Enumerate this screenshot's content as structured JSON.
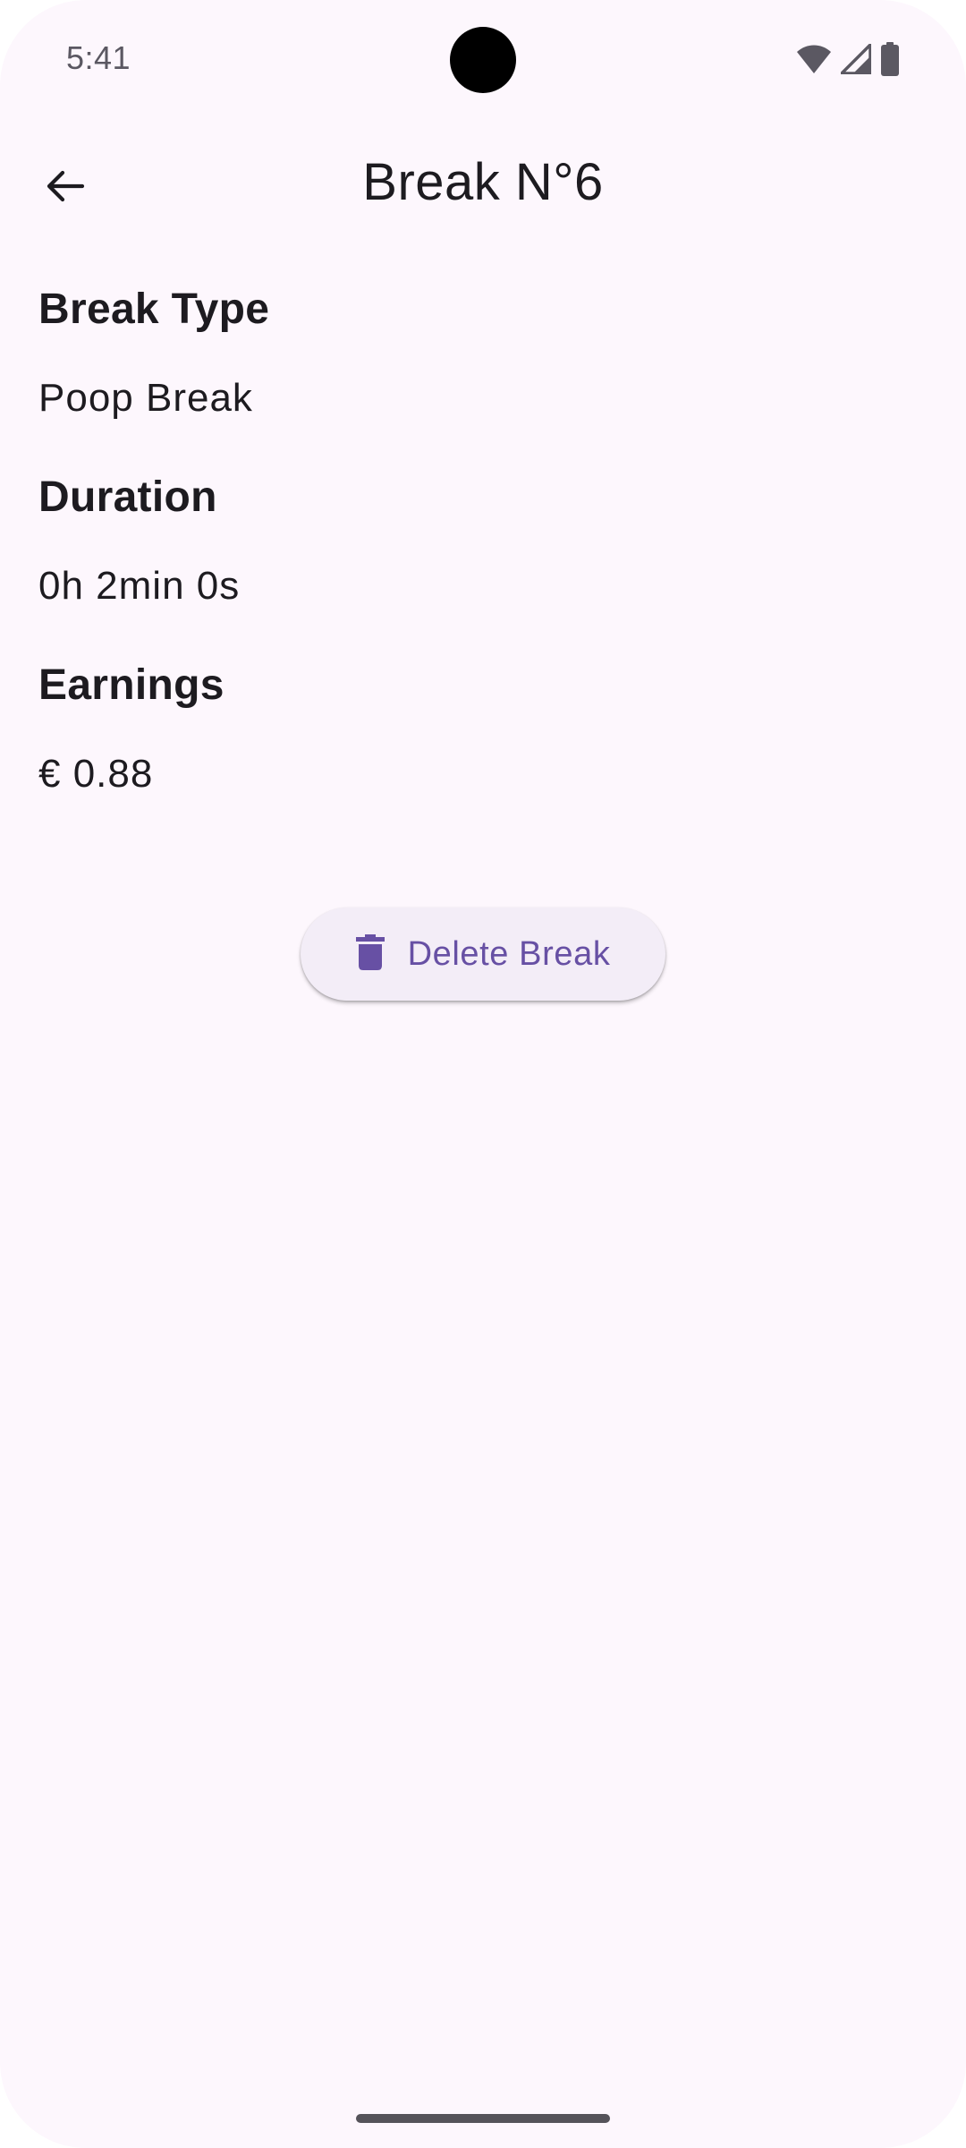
{
  "status_bar": {
    "time": "5:41",
    "icons": [
      "wifi-icon",
      "cellular-signal-icon",
      "battery-icon"
    ]
  },
  "app_bar": {
    "back_icon": "arrow-back-icon",
    "title": "Break N°6"
  },
  "details": {
    "break_type_label": "Break Type",
    "break_type_value": "Poop Break",
    "duration_label": "Duration",
    "duration_value": "0h 2min 0s",
    "earnings_label": "Earnings",
    "earnings_value": "€ 0.88"
  },
  "actions": {
    "delete_icon": "trash-icon",
    "delete_label": "Delete Break"
  },
  "colors": {
    "background": "#fdf7fd",
    "text": "#1d1b20",
    "accent": "#6750a4",
    "button_surface": "#f3edf7"
  }
}
